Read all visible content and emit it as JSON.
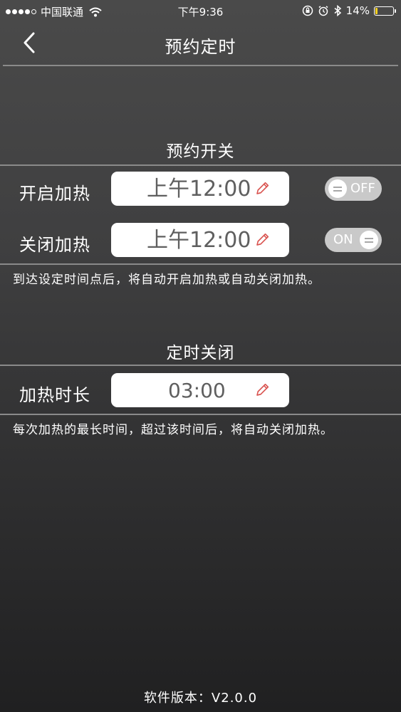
{
  "status_bar": {
    "carrier": "中国联通",
    "time": "下午9:36",
    "battery_percent": "14%",
    "battery_level": 0.14,
    "icons": [
      "signal-dots-icon",
      "wifi-icon",
      "rotation-lock-icon",
      "alarm-icon",
      "bluetooth-icon",
      "battery-icon"
    ]
  },
  "nav": {
    "title": "预约定时",
    "back_icon": "chevron-left-icon"
  },
  "schedule": {
    "title": "预约开关",
    "rows": [
      {
        "label": "开启加热",
        "time": "上午12:00",
        "toggle_label": "OFF",
        "toggle_on": false
      },
      {
        "label": "关闭加热",
        "time": "上午12:00",
        "toggle_label": "ON",
        "toggle_on": true
      }
    ],
    "hint": "到达设定时间点后，将自动开启加热或自动关闭加热。"
  },
  "timer": {
    "title": "定时关闭",
    "label": "加热时长",
    "value": "03:00",
    "hint": "每次加热的最长时间，超过该时间后，将自动关闭加热。"
  },
  "footer": {
    "version": "软件版本：V2.0.0"
  },
  "colors": {
    "toggle_bg": "#c9c9c9",
    "pencil": "#d9534f",
    "battery_fill": "#ffd21f",
    "divider": "#8a8a8a"
  }
}
